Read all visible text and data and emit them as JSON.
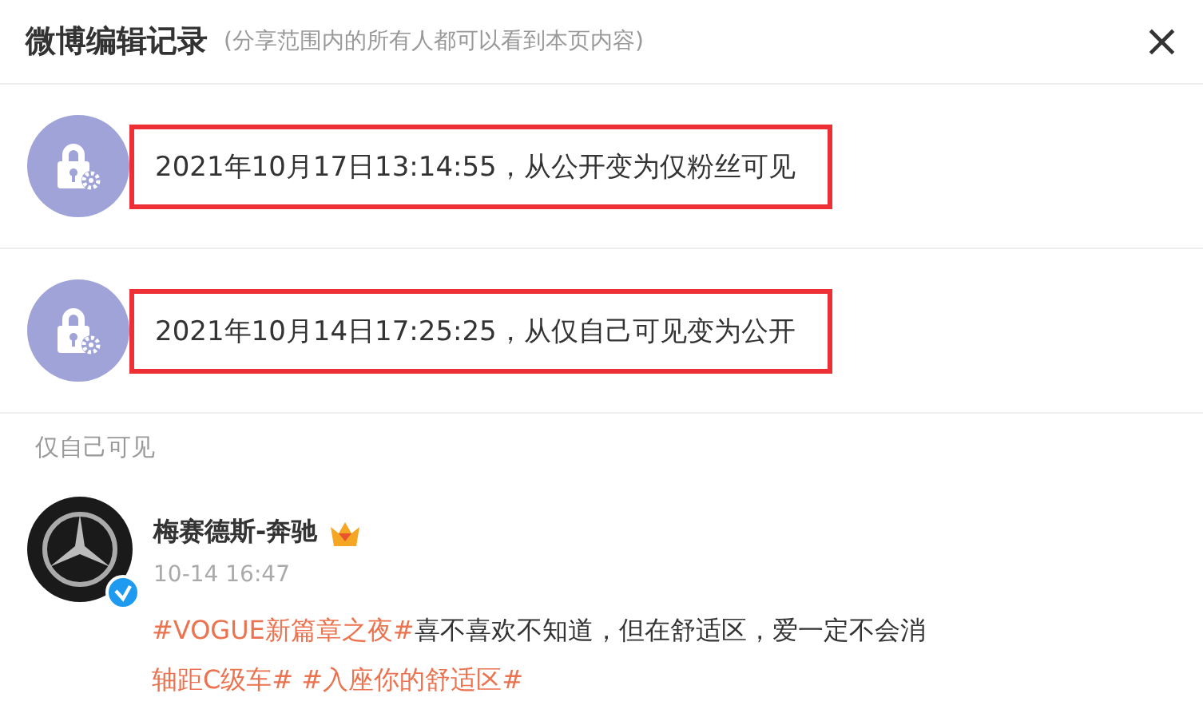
{
  "header": {
    "title": "微博编辑记录",
    "note": "(分享范围内的所有人都可以看到本页内容)",
    "close": "×"
  },
  "records": [
    {
      "text": "2021年10月17日13:14:55，从公开变为仅粉丝可见",
      "highlighted": true
    },
    {
      "text": "2021年10月14日17:25:25，从仅自己可见变为公开",
      "highlighted": true
    }
  ],
  "visibility_label": "仅自己可见",
  "post": {
    "author": "梅赛德斯-奔驰",
    "verified": true,
    "time": "10-14 16:47",
    "segments": [
      {
        "kind": "topic",
        "text": "#VOGUE新篇章之夜#"
      },
      {
        "kind": "text",
        "text": "喜不喜欢不知道，但在舒适区，爱一定不会消"
      },
      {
        "kind": "break"
      },
      {
        "kind": "topic",
        "text": "轴距C级车# #入座你的舒适区#"
      }
    ]
  }
}
